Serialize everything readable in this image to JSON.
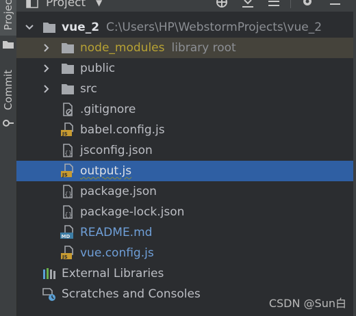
{
  "sidebar": {
    "project_tab": "Project",
    "commit_tab": "Commit"
  },
  "header": {
    "title": "Project"
  },
  "tree": {
    "root": {
      "name": "vue_2",
      "path": "C:\\Users\\HP\\WebstormProjects\\vue_2"
    },
    "node_modules": {
      "name": "node_modules",
      "note": "library root"
    },
    "public": "public",
    "src": "src",
    "gitignore": ".gitignore",
    "babel": "babel.config.js",
    "jsconfig": "jsconfig.json",
    "output": "output.js",
    "package": "package.json",
    "package_lock": "package-lock.json",
    "readme": "README.md",
    "vue_config": "vue.config.js",
    "external_libraries": "External Libraries",
    "scratches": "Scratches and Consoles"
  },
  "watermark": "CSDN @Sun白",
  "colors": {
    "background": "#2b2d30",
    "selection": "#2f5fa3",
    "highlight_row": "#45433b",
    "library_root": "#b7a234",
    "modified_file": "#6f9fd8"
  }
}
